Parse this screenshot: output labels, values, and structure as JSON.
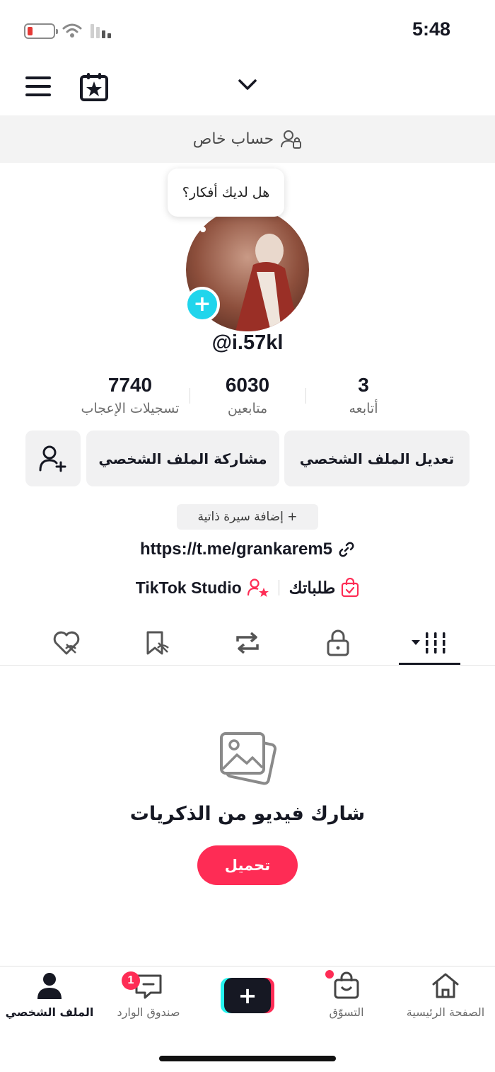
{
  "status_bar": {
    "time": "5:48"
  },
  "top_nav": {
    "title_glyph": "✓"
  },
  "private_banner": {
    "label": "حساب خاص"
  },
  "profile": {
    "bubble_text": "هل لديك أفكار؟",
    "username": "@i.57kl",
    "avatar_color": "#8a4a3a"
  },
  "stats": [
    {
      "value": "7740",
      "label": "تسجيلات الإعجاب"
    },
    {
      "value": "6030",
      "label": "متابعين"
    },
    {
      "value": "3",
      "label": "أتابعه"
    }
  ],
  "actions": {
    "edit_profile": "تعديل الملف الشخصي",
    "share_profile": "مشاركة الملف الشخصي"
  },
  "bio": {
    "add_bio": "+ إضافة سيرة ذاتية",
    "link": "https://t.me/grankarem5"
  },
  "extras": {
    "studio": "TikTok Studio",
    "orders": "طلباتك"
  },
  "tabs": [
    "videos-grid",
    "private",
    "reposts",
    "favorites",
    "liked"
  ],
  "empty_state": {
    "message": "شارك فيديو من الذكريات",
    "button": "تحميل"
  },
  "bottom_nav": {
    "profile": "الملف الشخصي",
    "inbox": "صندوق الوارد",
    "inbox_badge": "1",
    "shop": "التسوّق",
    "home": "الصفحة الرئيسية"
  },
  "colors": {
    "accent": "#fe2c55",
    "cyan": "#25f4ee",
    "plus_badge": "#20d5ec"
  }
}
